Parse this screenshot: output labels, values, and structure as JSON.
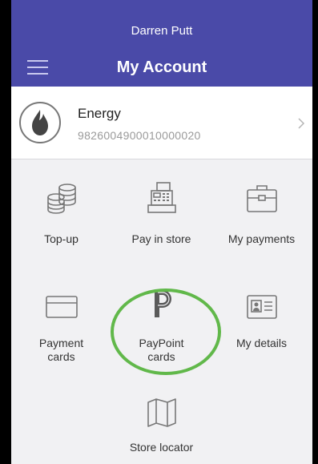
{
  "header": {
    "user_name": "Darren Putt",
    "title": "My Account"
  },
  "account": {
    "name": "Energy",
    "number": "9826004900010000020"
  },
  "tiles": [
    {
      "label": "Top-up",
      "icon": "coins-icon"
    },
    {
      "label": "Pay in store",
      "icon": "cash-register-icon"
    },
    {
      "label": "My payments",
      "icon": "briefcase-icon"
    },
    {
      "label": "Payment\ncards",
      "icon": "credit-card-icon"
    },
    {
      "label": "PayPoint\ncards",
      "icon": "paypoint-logo-icon"
    },
    {
      "label": "My details",
      "icon": "id-card-icon"
    },
    {
      "label": "Store locator",
      "icon": "map-icon"
    }
  ],
  "colors": {
    "header": "#4a4aa8",
    "highlight": "#61b84a"
  }
}
